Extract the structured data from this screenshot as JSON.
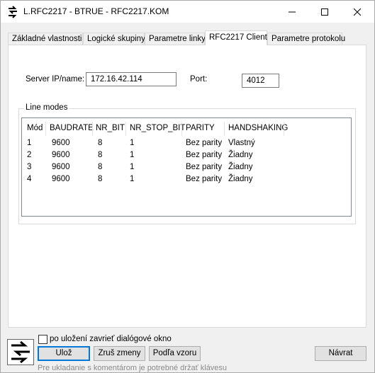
{
  "window": {
    "title": "L.RFC2217 - BTRUE - RFC2217.KOM",
    "icon": "serial-cable-icon",
    "controls": [
      "minimize",
      "maximize",
      "close"
    ]
  },
  "tabs": [
    {
      "label": "Základné vlastnosti",
      "active": false
    },
    {
      "label": "Logické skupiny",
      "active": false
    },
    {
      "label": "Parametre linky",
      "active": false
    },
    {
      "label": "RFC2217 Client",
      "active": true
    },
    {
      "label": "Parametre protokolu",
      "active": false
    }
  ],
  "server": {
    "label": "Server IP/name:",
    "value": "172.16.42.114",
    "port_label": "Port:",
    "port_value": "4012"
  },
  "line_modes": {
    "title": "Line modes",
    "columns": [
      "Mód",
      "BAUDRATE",
      "NR_BIT",
      "NR_STOP_BIT",
      "PARITY",
      "HANDSHAKING"
    ],
    "rows": [
      [
        "1",
        "9600",
        "8",
        "1",
        "Bez parity",
        "Vlastný"
      ],
      [
        "2",
        "9600",
        "8",
        "1",
        "Bez parity",
        "Žiadny"
      ],
      [
        "3",
        "9600",
        "8",
        "1",
        "Bez parity",
        "Žiadny"
      ],
      [
        "4",
        "9600",
        "8",
        "1",
        "Bez parity",
        "Žiadny"
      ]
    ]
  },
  "footer": {
    "checkbox_label": "po uložení zavrieť dialógové okno",
    "checkbox_checked": false,
    "save": "Ulož",
    "cancel": "Zruš zmeny",
    "template": "Podľa vzoru",
    "back": "Návrat",
    "hint": "Pre ukladanie s komentárom je potrebné držať klávesu"
  }
}
